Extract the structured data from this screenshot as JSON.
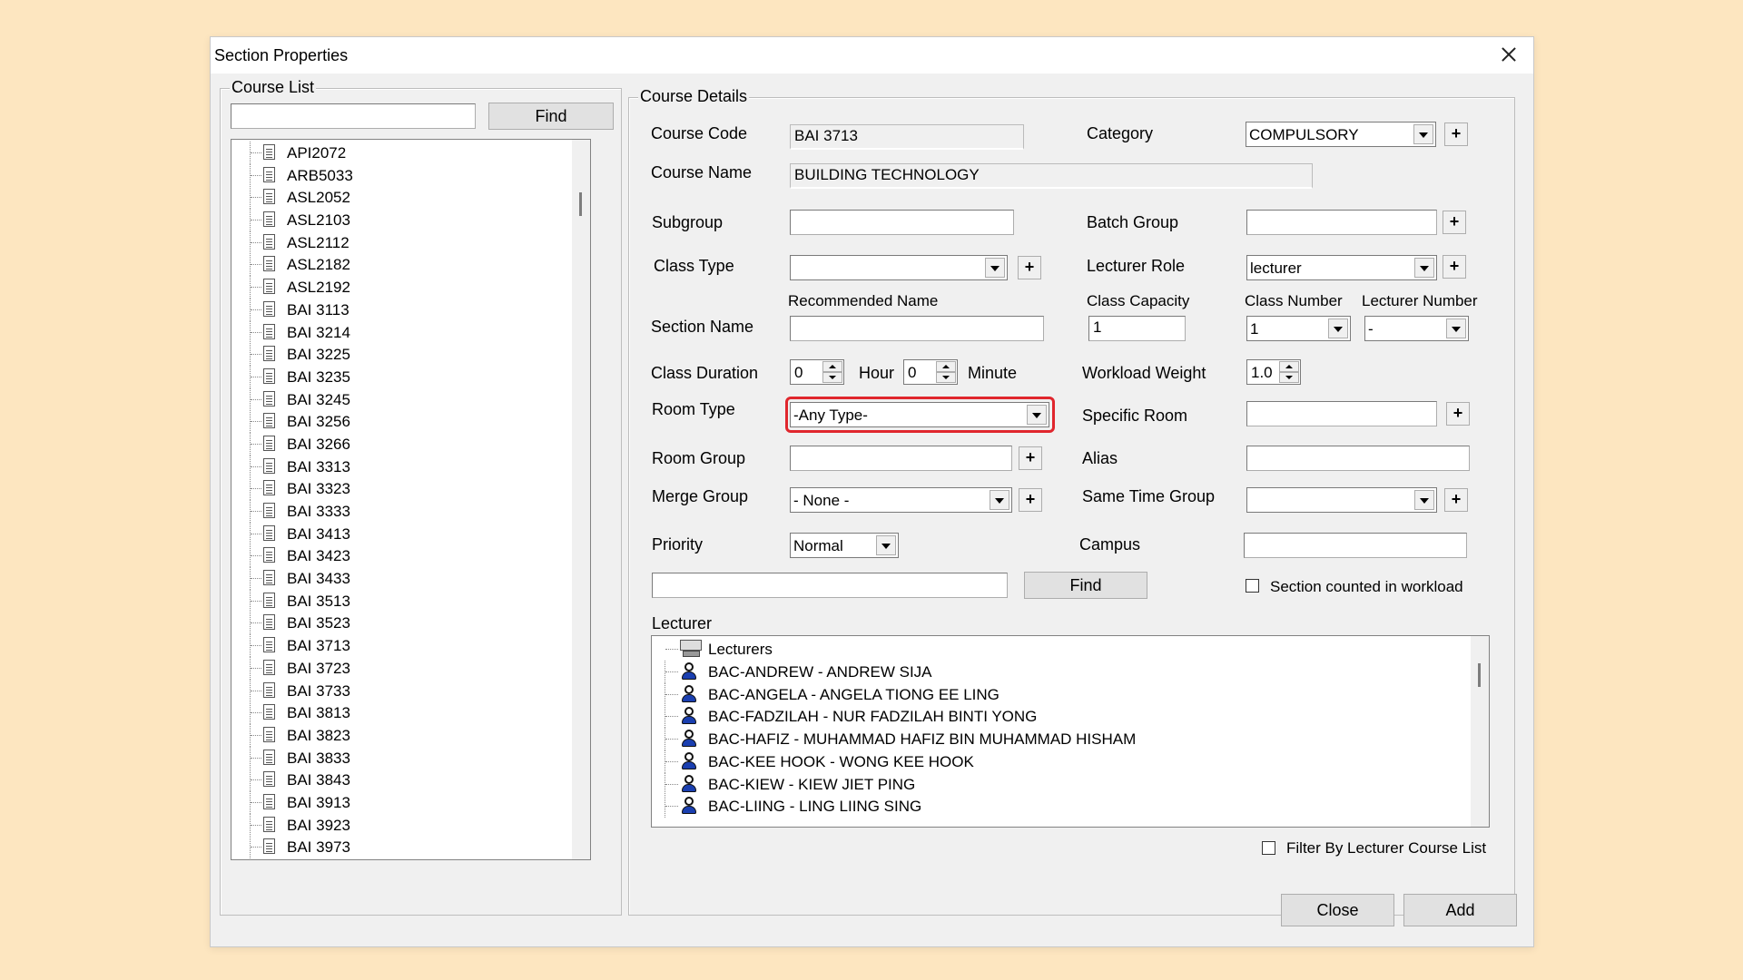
{
  "dialog": {
    "title": "Section Properties",
    "close_button_label": "Close",
    "add_button_label": "Add"
  },
  "course_list": {
    "legend": "Course List",
    "search_value": "",
    "find_label": "Find",
    "items": [
      "API2072",
      "ARB5033",
      "ASL2052",
      "ASL2103",
      "ASL2112",
      "ASL2182",
      "ASL2192",
      "BAI 3113",
      "BAI 3214",
      "BAI 3225",
      "BAI 3235",
      "BAI 3245",
      "BAI 3256",
      "BAI 3266",
      "BAI 3313",
      "BAI 3323",
      "BAI 3333",
      "BAI 3413",
      "BAI 3423",
      "BAI 3433",
      "BAI 3513",
      "BAI 3523",
      "BAI 3713",
      "BAI 3723",
      "BAI 3733",
      "BAI 3813",
      "BAI 3823",
      "BAI 3833",
      "BAI 3843",
      "BAI 3913",
      "BAI 3923",
      "BAI 3973"
    ]
  },
  "details": {
    "legend": "Course Details",
    "course_code_label": "Course Code",
    "course_code": "BAI 3713",
    "course_name_label": "Course Name",
    "course_name": "BUILDING TECHNOLOGY",
    "category_label": "Category",
    "category": "COMPULSORY",
    "subgroup_label": "Subgroup",
    "subgroup": "",
    "batch_group_label": "Batch Group",
    "batch_group": "",
    "class_type_label": "Class Type",
    "class_type": "",
    "lecturer_role_label": "Lecturer Role",
    "lecturer_role": "lecturer",
    "recommended_name_label": "Recommended Name",
    "class_capacity_label": "Class Capacity",
    "class_number_label": "Class Number",
    "lecturer_number_label": "Lecturer Number",
    "section_name_label": "Section Name",
    "section_name": "",
    "class_capacity": "1",
    "class_number": "1",
    "lecturer_number": "-",
    "class_duration_label": "Class Duration",
    "duration_hours": "0",
    "hour_label": "Hour",
    "duration_minutes": "0",
    "minute_label": "Minute",
    "workload_weight_label": "Workload Weight",
    "workload_weight": "1.0",
    "room_type_label": "Room Type",
    "room_type": "-Any Type-",
    "specific_room_label": "Specific Room",
    "specific_room": "",
    "room_group_label": "Room Group",
    "room_group": "",
    "alias_label": "Alias",
    "alias": "",
    "merge_group_label": "Merge Group",
    "merge_group": "- None -",
    "same_time_group_label": "Same Time Group",
    "same_time_group": "",
    "priority_label": "Priority",
    "priority": "Normal",
    "campus_label": "Campus",
    "campus": "",
    "lecturer_search_value": "",
    "find_label": "Find",
    "section_counted_label": "Section counted in workload",
    "section_counted_checked": false,
    "lecturer_label": "Lecturer",
    "filter_label": "Filter By Lecturer Course List",
    "filter_checked": false
  },
  "lecturers": {
    "root": "Lecturers",
    "items": [
      "BAC-ANDREW - ANDREW SIJA",
      "BAC-ANGELA - ANGELA TIONG EE LING",
      "BAC-FADZILAH - NUR FADZILAH BINTI YONG",
      "BAC-HAFIZ - MUHAMMAD HAFIZ BIN MUHAMMAD HISHAM",
      "BAC-KEE HOOK - WONG KEE HOOK",
      "BAC-KIEW - KIEW JIET PING",
      "BAC-LIING - LING LIING SING"
    ]
  },
  "colors": {
    "background": "#fde6c0",
    "highlight": "#e0262d",
    "person_icon": "#1a3fb0"
  }
}
